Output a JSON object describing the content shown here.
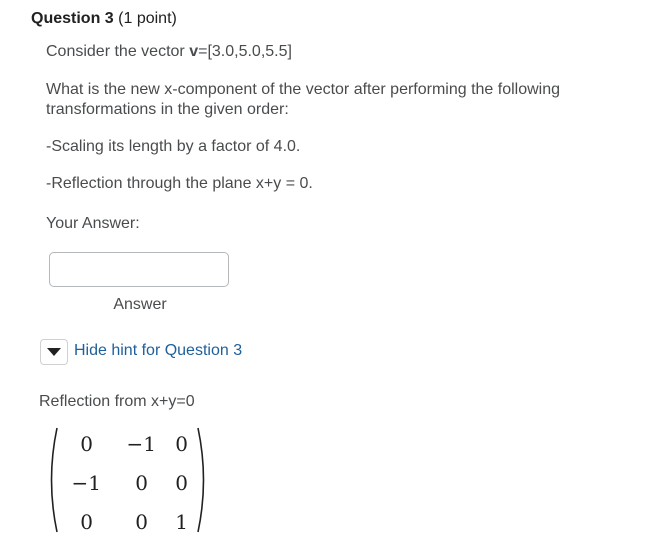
{
  "question": {
    "label": "Question 3",
    "points": "(1 point)",
    "consider": "Consider the vector ",
    "vector_name": "v",
    "vector_value": "=[3.0,5.0,5.5]",
    "prompt": "What is the new x-component of the vector after performing the following transformations in the given order:",
    "steps": [
      "-Scaling its length by a factor of 4.0.",
      "-Reflection through the plane x+y = 0."
    ],
    "your_answer": "Your Answer:"
  },
  "answer": {
    "value": "",
    "label": "Answer"
  },
  "hint": {
    "toggle_icon": "caret-down-icon",
    "link_text": "Hide hint for Question 3",
    "reflection_label": "Reflection from x+y=0",
    "matrix": [
      [
        "0",
        "−1",
        "0"
      ],
      [
        "−1",
        "0",
        "0"
      ],
      [
        "0",
        "0",
        "1"
      ]
    ]
  },
  "colors": {
    "link": "#1f5f9a",
    "text": "#494c4e",
    "heading": "#202122",
    "border": "#b5b8ba"
  }
}
